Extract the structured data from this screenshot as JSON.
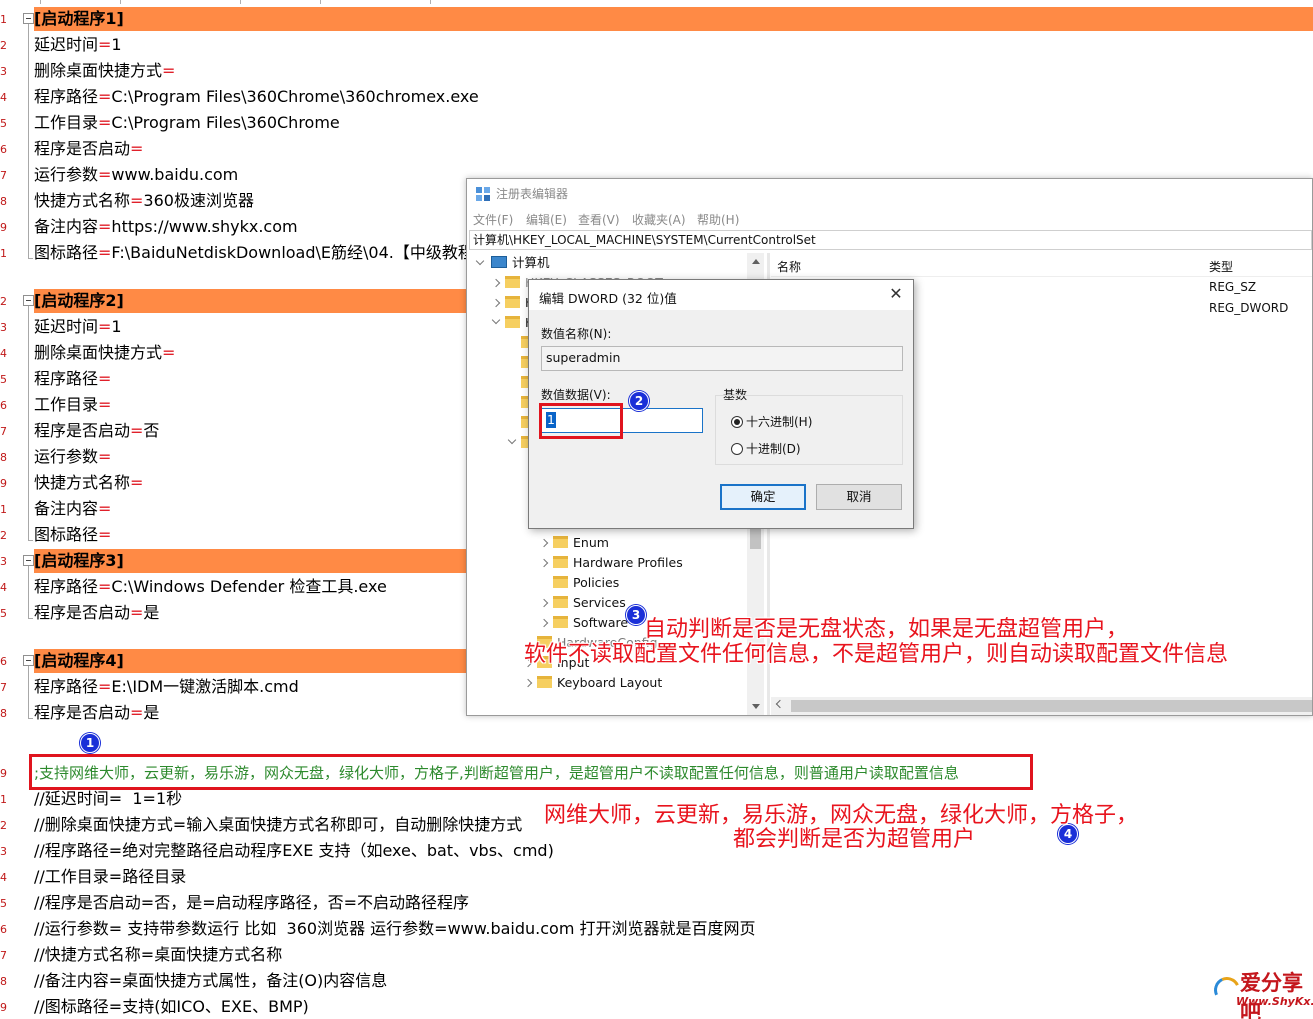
{
  "editor": {
    "sections": [
      {
        "title": "[启动程序1]",
        "lines": [
          {
            "k": "延迟时间",
            "v": "1"
          },
          {
            "k": "删除桌面快捷方式",
            "v": ""
          },
          {
            "k": "程序路径",
            "v": "C:\\Program Files\\360Chrome\\360chromex.exe"
          },
          {
            "k": "工作目录",
            "v": "C:\\Program Files\\360Chrome"
          },
          {
            "k": "程序是否启动",
            "v": ""
          },
          {
            "k": "运行参数",
            "v": "www.baidu.com"
          },
          {
            "k": "快捷方式名称",
            "v": "360极速浏览器"
          },
          {
            "k": "备注内容",
            "v": "https://www.shykx.com"
          },
          {
            "k": "图标路径",
            "v": "F:\\BaiduNetdiskDownload\\E筋经\\04.【中级教程"
          }
        ]
      },
      {
        "title": "[启动程序2]",
        "lines": [
          {
            "k": "延迟时间",
            "v": "1"
          },
          {
            "k": "删除桌面快捷方式",
            "v": ""
          },
          {
            "k": "程序路径",
            "v": ""
          },
          {
            "k": "工作目录",
            "v": ""
          },
          {
            "k": "程序是否启动",
            "v": "否"
          },
          {
            "k": "运行参数",
            "v": ""
          },
          {
            "k": "快捷方式名称",
            "v": ""
          },
          {
            "k": "备注内容",
            "v": ""
          },
          {
            "k": "图标路径",
            "v": ""
          }
        ]
      },
      {
        "title": "[启动程序3]",
        "lines": [
          {
            "k": "程序路径",
            "v": "C:\\Windows Defender 检查工具.exe"
          },
          {
            "k": "程序是否启动",
            "v": "是"
          }
        ]
      },
      {
        "title": "[启动程序4]",
        "lines": [
          {
            "k": "程序路径",
            "v": "E:\\IDM一键激活脚本.cmd"
          },
          {
            "k": "程序是否启动",
            "v": "是"
          }
        ]
      }
    ],
    "comment_line": ";支持网维大师，云更新，易乐游，网众无盘，绿化大师，方格子,判断超管用户，是超管用户不读取配置任何信息，则普通用户读取配置信息",
    "help_lines": [
      "//延迟时间=  1=1秒",
      "//删除桌面快捷方式=输入桌面快捷方式名称即可，自动删除快捷方式",
      "//程序路径=绝对完整路径启动程序EXE 支持（如exe、bat、vbs、cmd)",
      "//工作目录=路径目录",
      "//程序是否启动=否，是=启动程序路径，否=不启动路径程序",
      "//运行参数= 支持带参数运行 比如  360浏览器 运行参数=www.baidu.com 打开浏览器就是百度网页",
      "//快捷方式名称=桌面快捷方式名称",
      "//备注内容=桌面快捷方式属性，备注(O)内容信息",
      "//图标路径=支持(如ICO、EXE、BMP)"
    ]
  },
  "registry": {
    "title": "注册表编辑器",
    "menu": [
      "文件(F)",
      "编辑(E)",
      "查看(V)",
      "收藏夹(A)",
      "帮助(H)"
    ],
    "address": "计算机\\HKEY_LOCAL_MACHINE\\SYSTEM\\CurrentControlSet",
    "tree_root": "计算机",
    "tree_items": [
      "Enum",
      "Hardware Profiles",
      "Policies",
      "Services",
      "Software",
      "HardwareConfig",
      "Input",
      "Keyboard Layout"
    ],
    "tree_stub": "H",
    "tree_peek": "HKEY_CLASSES_ROOT",
    "columns": {
      "name": "名称",
      "type": "类型"
    },
    "types": [
      "REG_SZ",
      "REG_DWORD"
    ]
  },
  "dialog": {
    "title": "编辑 DWORD (32 位)值",
    "close": "✕",
    "name_label": "数值名称(N):",
    "name_value": "superadmin",
    "data_label": "数值数据(V):",
    "data_value": "1",
    "base_label": "基数",
    "hex_label": "十六进制(H)",
    "dec_label": "十进制(D)",
    "ok": "确定",
    "cancel": "取消"
  },
  "annotations": {
    "badges": [
      "1",
      "2",
      "3",
      "4"
    ],
    "note3_line1": "自动判断是否是无盘状态，如果是无盘超管用户，",
    "note3_line2": "软件不读取配置文件任何信息，不是超管用户，则自动读取配置文件信息",
    "note4_line1": "网维大师，云更新，易乐游，网众无盘，绿化大师，方格子，",
    "note4_line2": "都会判断是否为超管用户"
  },
  "watermark": {
    "brand": "爱分享吧",
    "url": "Www.ShyKx.Com"
  },
  "colors": {
    "section_band": "#ff8a45",
    "equals": "#e0202a",
    "comment": "#2d8a2d",
    "annotation": "#e8141e",
    "badge": "#1a2fd8"
  }
}
